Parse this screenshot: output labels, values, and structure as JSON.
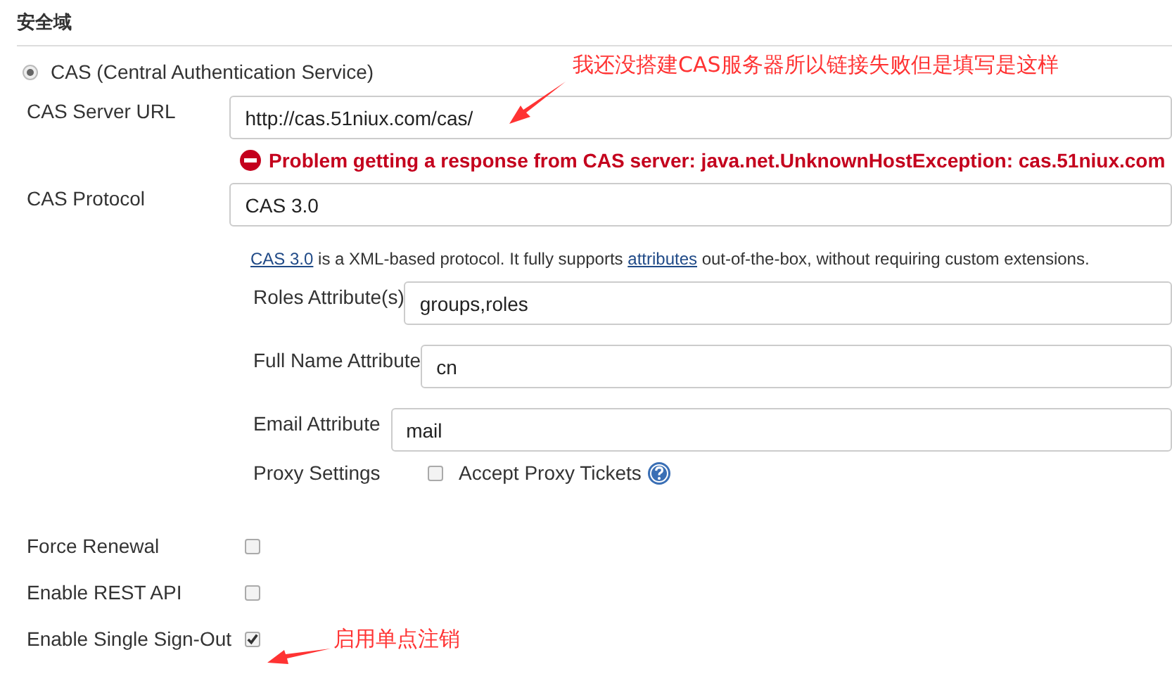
{
  "section": {
    "title": "安全域"
  },
  "realm": {
    "label": "CAS (Central Authentication Service)",
    "selected": true
  },
  "server_url": {
    "label": "CAS Server URL",
    "value": "http://cas.51niux.com/cas/"
  },
  "error": {
    "text": "Problem getting a response from CAS server: java.net.UnknownHostException: cas.51niux.com"
  },
  "protocol": {
    "label": "CAS Protocol",
    "value": "CAS 3.0"
  },
  "protocol_help": [
    {
      "kind": "link",
      "text": "CAS 3.0"
    },
    {
      "kind": "text",
      "text": " is a XML-based protocol. It fully supports "
    },
    {
      "kind": "link",
      "text": "attributes"
    },
    {
      "kind": "text",
      "text": " out-of-the-box, without requiring custom extensions."
    }
  ],
  "attributes": [
    {
      "label": "Roles Attribute(s)",
      "value": "groups,roles"
    },
    {
      "label": "Full Name Attribute",
      "value": "cn"
    },
    {
      "label": "Email Attribute",
      "value": "mail"
    }
  ],
  "proxy": {
    "label": "Proxy Settings",
    "option": "Accept Proxy Tickets",
    "checked": false
  },
  "options": [
    {
      "label": "Force Renewal",
      "checked": false
    },
    {
      "label": "Enable REST API",
      "checked": false
    },
    {
      "label": "Enable Single Sign-Out",
      "checked": true
    }
  ],
  "annotations": [
    {
      "text": "我还没搭建CAS服务器所以链接失败但是填写是这样"
    },
    {
      "text": "启用单点注销"
    }
  ]
}
